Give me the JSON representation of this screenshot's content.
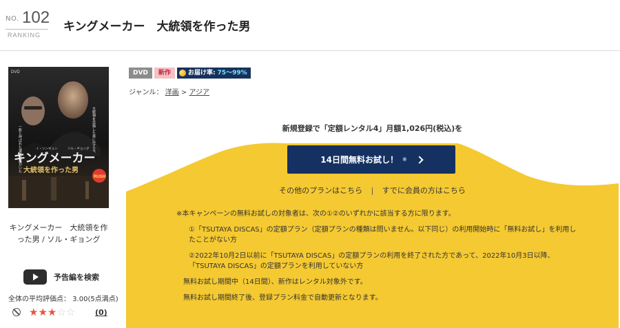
{
  "ranking": {
    "prefix": "NO.",
    "number": "102",
    "label": "RANKING"
  },
  "title": "キングメーカー　大統領を作った男",
  "cover": {
    "format_label": "DVD",
    "title_line1": "キングメーカー",
    "title_line2": "大統領を作った男",
    "cast_left": "イ・ソンギュン",
    "cast_right": "ソル・ギョング",
    "vertical_copy_right": "大統領を目指した男に仕える、",
    "vertical_copy_left": "一影と呼ばれた選挙参謀がいた",
    "sticker": "RUSH"
  },
  "product": {
    "title_cast": "キングメーカー　大統領を作った男 / ソル・ギョング",
    "trailer_label": "予告編を検索",
    "avg_rating_text": "全体の平均評価点： 3.00(5点満点)",
    "rating_value": 3,
    "rating_max": 5,
    "review_count": "(0)"
  },
  "badges": {
    "dvd": "DVD",
    "new": "新作",
    "delivery_label": "お届け率:",
    "delivery_value": "75～99%"
  },
  "genre": {
    "label": "ジャンル：",
    "item1": "洋画",
    "sep": ">",
    "item2": "アジア"
  },
  "offer": {
    "headline": "新規登録で「定額レンタル4」月額1,026円(税込)を",
    "cta_label": "14日間無料お試し！",
    "cta_mark": "※",
    "other_plans": "その他のプランはこちら",
    "separator": "|",
    "member_link": "すでに会員の方はこちら"
  },
  "notes": {
    "n1": "※本キャンペーンの無料お試しの対象者は、次の①②のいずれかに該当する方に限ります。",
    "n2": "①「TSUTAYA DISCAS」の定額プラン（定額プランの種類は問いません。以下同じ）の利用開始時に「無料お試し」を利用したことがない方",
    "n3": "②2022年10月2日以前に「TSUTAYA DISCAS」の定額プランの利用を終了された方であって、2022年10月3日以降、「TSUTAYA DISCAS」の定額プランを利用していない方",
    "n4": "無料お試し期間中（14日間）、新作はレンタル対象外です。",
    "n5": "無料お試し期間終了後、登録プラン料金で自動更新となります。"
  },
  "colors": {
    "accent_yellow": "#f5c931",
    "cta_navy": "#153161",
    "star": "#e8553d"
  }
}
